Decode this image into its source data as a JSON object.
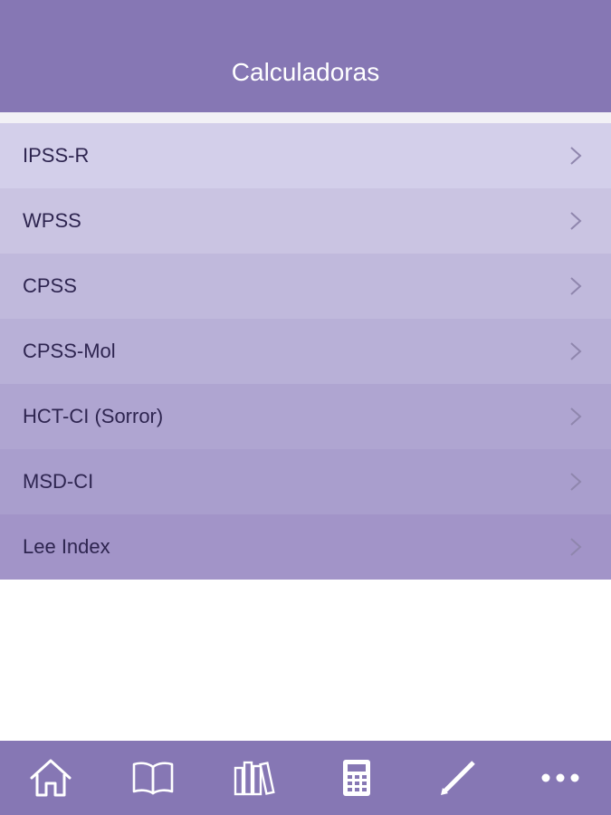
{
  "header": {
    "title": "Calculadoras"
  },
  "list": {
    "items": [
      {
        "label": "IPSS-R"
      },
      {
        "label": "WPSS"
      },
      {
        "label": "CPSS"
      },
      {
        "label": "CPSS-Mol"
      },
      {
        "label": "HCT-CI (Sorror)"
      },
      {
        "label": "MSD-CI"
      },
      {
        "label": "Lee Index"
      }
    ]
  },
  "tabbar": {
    "tabs": [
      {
        "icon": "home-icon"
      },
      {
        "icon": "book-icon"
      },
      {
        "icon": "library-icon"
      },
      {
        "icon": "calculator-icon"
      },
      {
        "icon": "pencil-icon"
      },
      {
        "icon": "more-icon"
      }
    ]
  },
  "colors": {
    "header_bg": "#8677b4",
    "tabbar_bg": "#8677b4",
    "text": "#2e2550",
    "chevron": "#8f86ad"
  }
}
